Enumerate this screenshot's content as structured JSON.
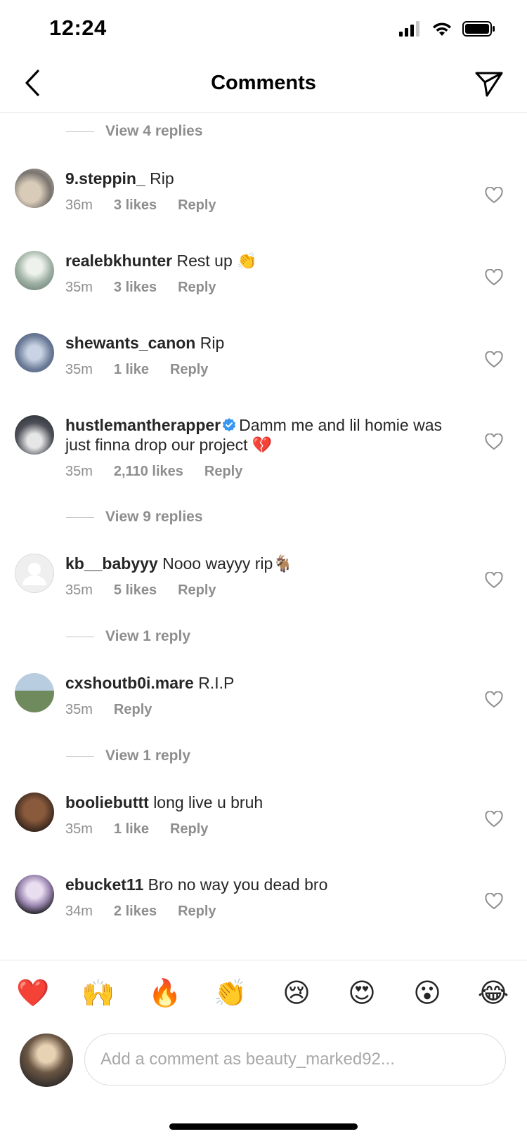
{
  "status_bar": {
    "time": "12:24"
  },
  "header": {
    "title": "Comments"
  },
  "view_replies": [
    {
      "text": "View 4 replies"
    },
    {
      "text": "View 9 replies"
    },
    {
      "text": "View 1 reply"
    },
    {
      "text": "View 1 reply"
    }
  ],
  "comments": [
    {
      "username": "9.steppin_",
      "text": "Rip",
      "time": "36m",
      "likes": "3 likes",
      "reply": "Reply"
    },
    {
      "username": "realebkhunter",
      "text": "Rest up 👏",
      "time": "35m",
      "likes": "3 likes",
      "reply": "Reply"
    },
    {
      "username": "shewants_canon",
      "text": "Rip",
      "time": "35m",
      "likes": "1 like",
      "reply": "Reply"
    },
    {
      "username": "hustlemantherapper",
      "verified": true,
      "text": "Damm me and lil homie was just finna drop our project 💔",
      "time": "35m",
      "likes": "2,110 likes",
      "reply": "Reply"
    },
    {
      "username": "kb__babyyy",
      "text": "Nooo wayyy rip🐐",
      "time": "35m",
      "likes": "5 likes",
      "reply": "Reply"
    },
    {
      "username": "cxshoutb0i.mare",
      "text": "R.I.P",
      "time": "35m",
      "reply": "Reply"
    },
    {
      "username": "booliebuttt",
      "text": "long live u bruh",
      "time": "35m",
      "likes": "1 like",
      "reply": "Reply"
    },
    {
      "username": "ebucket11",
      "text": "Bro no way you dead bro",
      "time": "34m",
      "likes": "2 likes",
      "reply": "Reply"
    }
  ],
  "emoji_bar": [
    "❤️",
    "🙌",
    "🔥",
    "👏",
    "😢",
    "😍",
    "😮",
    "😂"
  ],
  "composer": {
    "placeholder": "Add a comment as beauty_marked92..."
  },
  "colors": {
    "text": "#262626",
    "muted": "#8e8e8e",
    "verified": "#3897f0",
    "divider": "#e6e6e6"
  }
}
